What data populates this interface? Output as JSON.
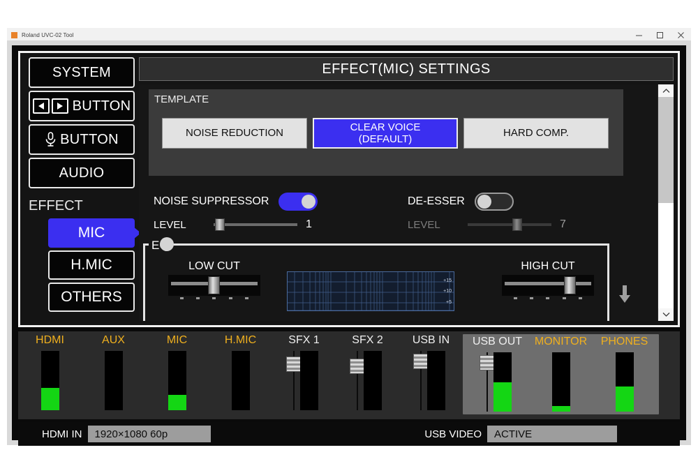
{
  "window": {
    "title": "Roland UVC-02 Tool",
    "controls": [
      "minimize",
      "maximize",
      "close"
    ]
  },
  "sidebar": {
    "items": [
      {
        "label": "SYSTEM",
        "icon": "none",
        "selected": false
      },
      {
        "label": "BUTTON",
        "icon": "dpad-arrows-icon",
        "selected": false
      },
      {
        "label": "BUTTON",
        "icon": "microphone-icon",
        "selected": false
      },
      {
        "label": "AUDIO",
        "icon": "none",
        "selected": false
      }
    ],
    "group_label": "EFFECT",
    "sub_items": [
      {
        "label": "MIC",
        "selected": true
      },
      {
        "label": "H.MIC",
        "selected": false
      },
      {
        "label": "OTHERS",
        "selected": false
      }
    ]
  },
  "pane": {
    "title": "EFFECT(MIC) SETTINGS",
    "template": {
      "legend": "TEMPLATE",
      "buttons": [
        {
          "label": "NOISE REDUCTION",
          "selected": false
        },
        {
          "label": "CLEAR VOICE\n(DEFAULT)",
          "line1": "CLEAR VOICE",
          "line2": "(DEFAULT)",
          "selected": true
        },
        {
          "label": "HARD COMP.",
          "selected": false
        }
      ]
    },
    "noise_suppressor": {
      "label": "NOISE SUPPRESSOR",
      "enabled": true,
      "level_label": "LEVEL",
      "level_value": "1",
      "level_percent": 2
    },
    "de_esser": {
      "label": "DE-ESSER",
      "enabled": false,
      "level_label": "LEVEL",
      "level_value": "7",
      "level_percent": 60
    },
    "eq": {
      "legend": "EQ",
      "enabled": true,
      "low_cut": {
        "label": "LOW CUT",
        "percent": 46
      },
      "high_cut": {
        "label": "HIGH CUT",
        "percent": 76
      },
      "graph": {
        "gain_labels": [
          "+15",
          "+10",
          "+5"
        ]
      }
    },
    "scroll_down_icon": "arrow-down-icon",
    "scrollbar": {
      "up_icon": "chevron-up-icon",
      "down_icon": "chevron-down-icon",
      "thumb_percent": 50
    }
  },
  "mixer": {
    "channels": [
      {
        "name": "HDMI",
        "color": "#f0b01e",
        "type": "meter",
        "meter_percent": 38,
        "grouped": false
      },
      {
        "name": "AUX",
        "color": "#f0b01e",
        "type": "meter",
        "meter_percent": 0,
        "grouped": false
      },
      {
        "name": "MIC",
        "color": "#f0b01e",
        "type": "meter",
        "meter_percent": 26,
        "grouped": false
      },
      {
        "name": "H.MIC",
        "color": "#f0b01e",
        "type": "meter",
        "meter_percent": 0,
        "grouped": false
      },
      {
        "name": "SFX 1",
        "color": "#efefef",
        "type": "fader",
        "fader_percent": 12,
        "meter_percent": 0,
        "grouped": false
      },
      {
        "name": "SFX 2",
        "color": "#efefef",
        "type": "fader",
        "fader_percent": 18,
        "meter_percent": 0,
        "grouped": false
      },
      {
        "name": "USB IN",
        "color": "#efefef",
        "type": "fader",
        "fader_percent": 6,
        "meter_percent": 0,
        "grouped": false
      },
      {
        "name": "USB OUT",
        "color": "#efefef",
        "type": "fader",
        "fader_percent": 6,
        "meter_percent": 50,
        "grouped": true
      },
      {
        "name": "MONITOR",
        "color": "#f0b01e",
        "type": "meter",
        "meter_percent": 9,
        "grouped": true
      },
      {
        "name": "PHONES",
        "color": "#f0b01e",
        "type": "meter",
        "meter_percent": 42,
        "grouped": true
      }
    ]
  },
  "status": {
    "hdmi_in_label": "HDMI IN",
    "hdmi_in_value": "1920×1080 60p",
    "usb_video_label": "USB VIDEO",
    "usb_video_value": "ACTIVE"
  },
  "colors": {
    "accent_blue": "#3b2ff0",
    "meter_green": "#14d614",
    "label_gold": "#f0b01e",
    "panel_dark": "#161616"
  }
}
